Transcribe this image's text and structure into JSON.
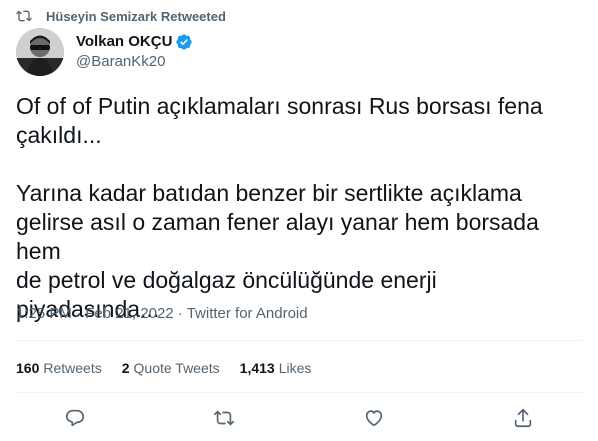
{
  "retweet_context": {
    "text": "Hüseyin Semizark Retweeted",
    "icon": "retweet-icon"
  },
  "author": {
    "display_name": "Volkan OKÇU",
    "handle": "@BaranKk20",
    "verified_color": "#1d9bf0"
  },
  "tweet": {
    "paragraph1": "Of of of Putin açıklamaları sonrası Rus borsası fena\nçakıldı...",
    "paragraph2": "Yarına kadar batıdan benzer bir sertlikte açıklama\ngelirse asıl o zaman fener alayı yanar hem borsada hem\nde petrol ve doğalgaz öncülüğünde enerji\npiyadasında..."
  },
  "meta": {
    "time": "1:25 PM",
    "separator": "·",
    "date": "Feb 21, 2022",
    "source": "Twitter for Android"
  },
  "stats": {
    "retweets_count": "160",
    "retweets_label": "Retweets",
    "quotes_count": "2",
    "quotes_label": "Quote Tweets",
    "likes_count": "1,413",
    "likes_label": "Likes"
  },
  "actions": [
    "reply-icon",
    "retweet-icon",
    "like-icon",
    "share-icon"
  ]
}
